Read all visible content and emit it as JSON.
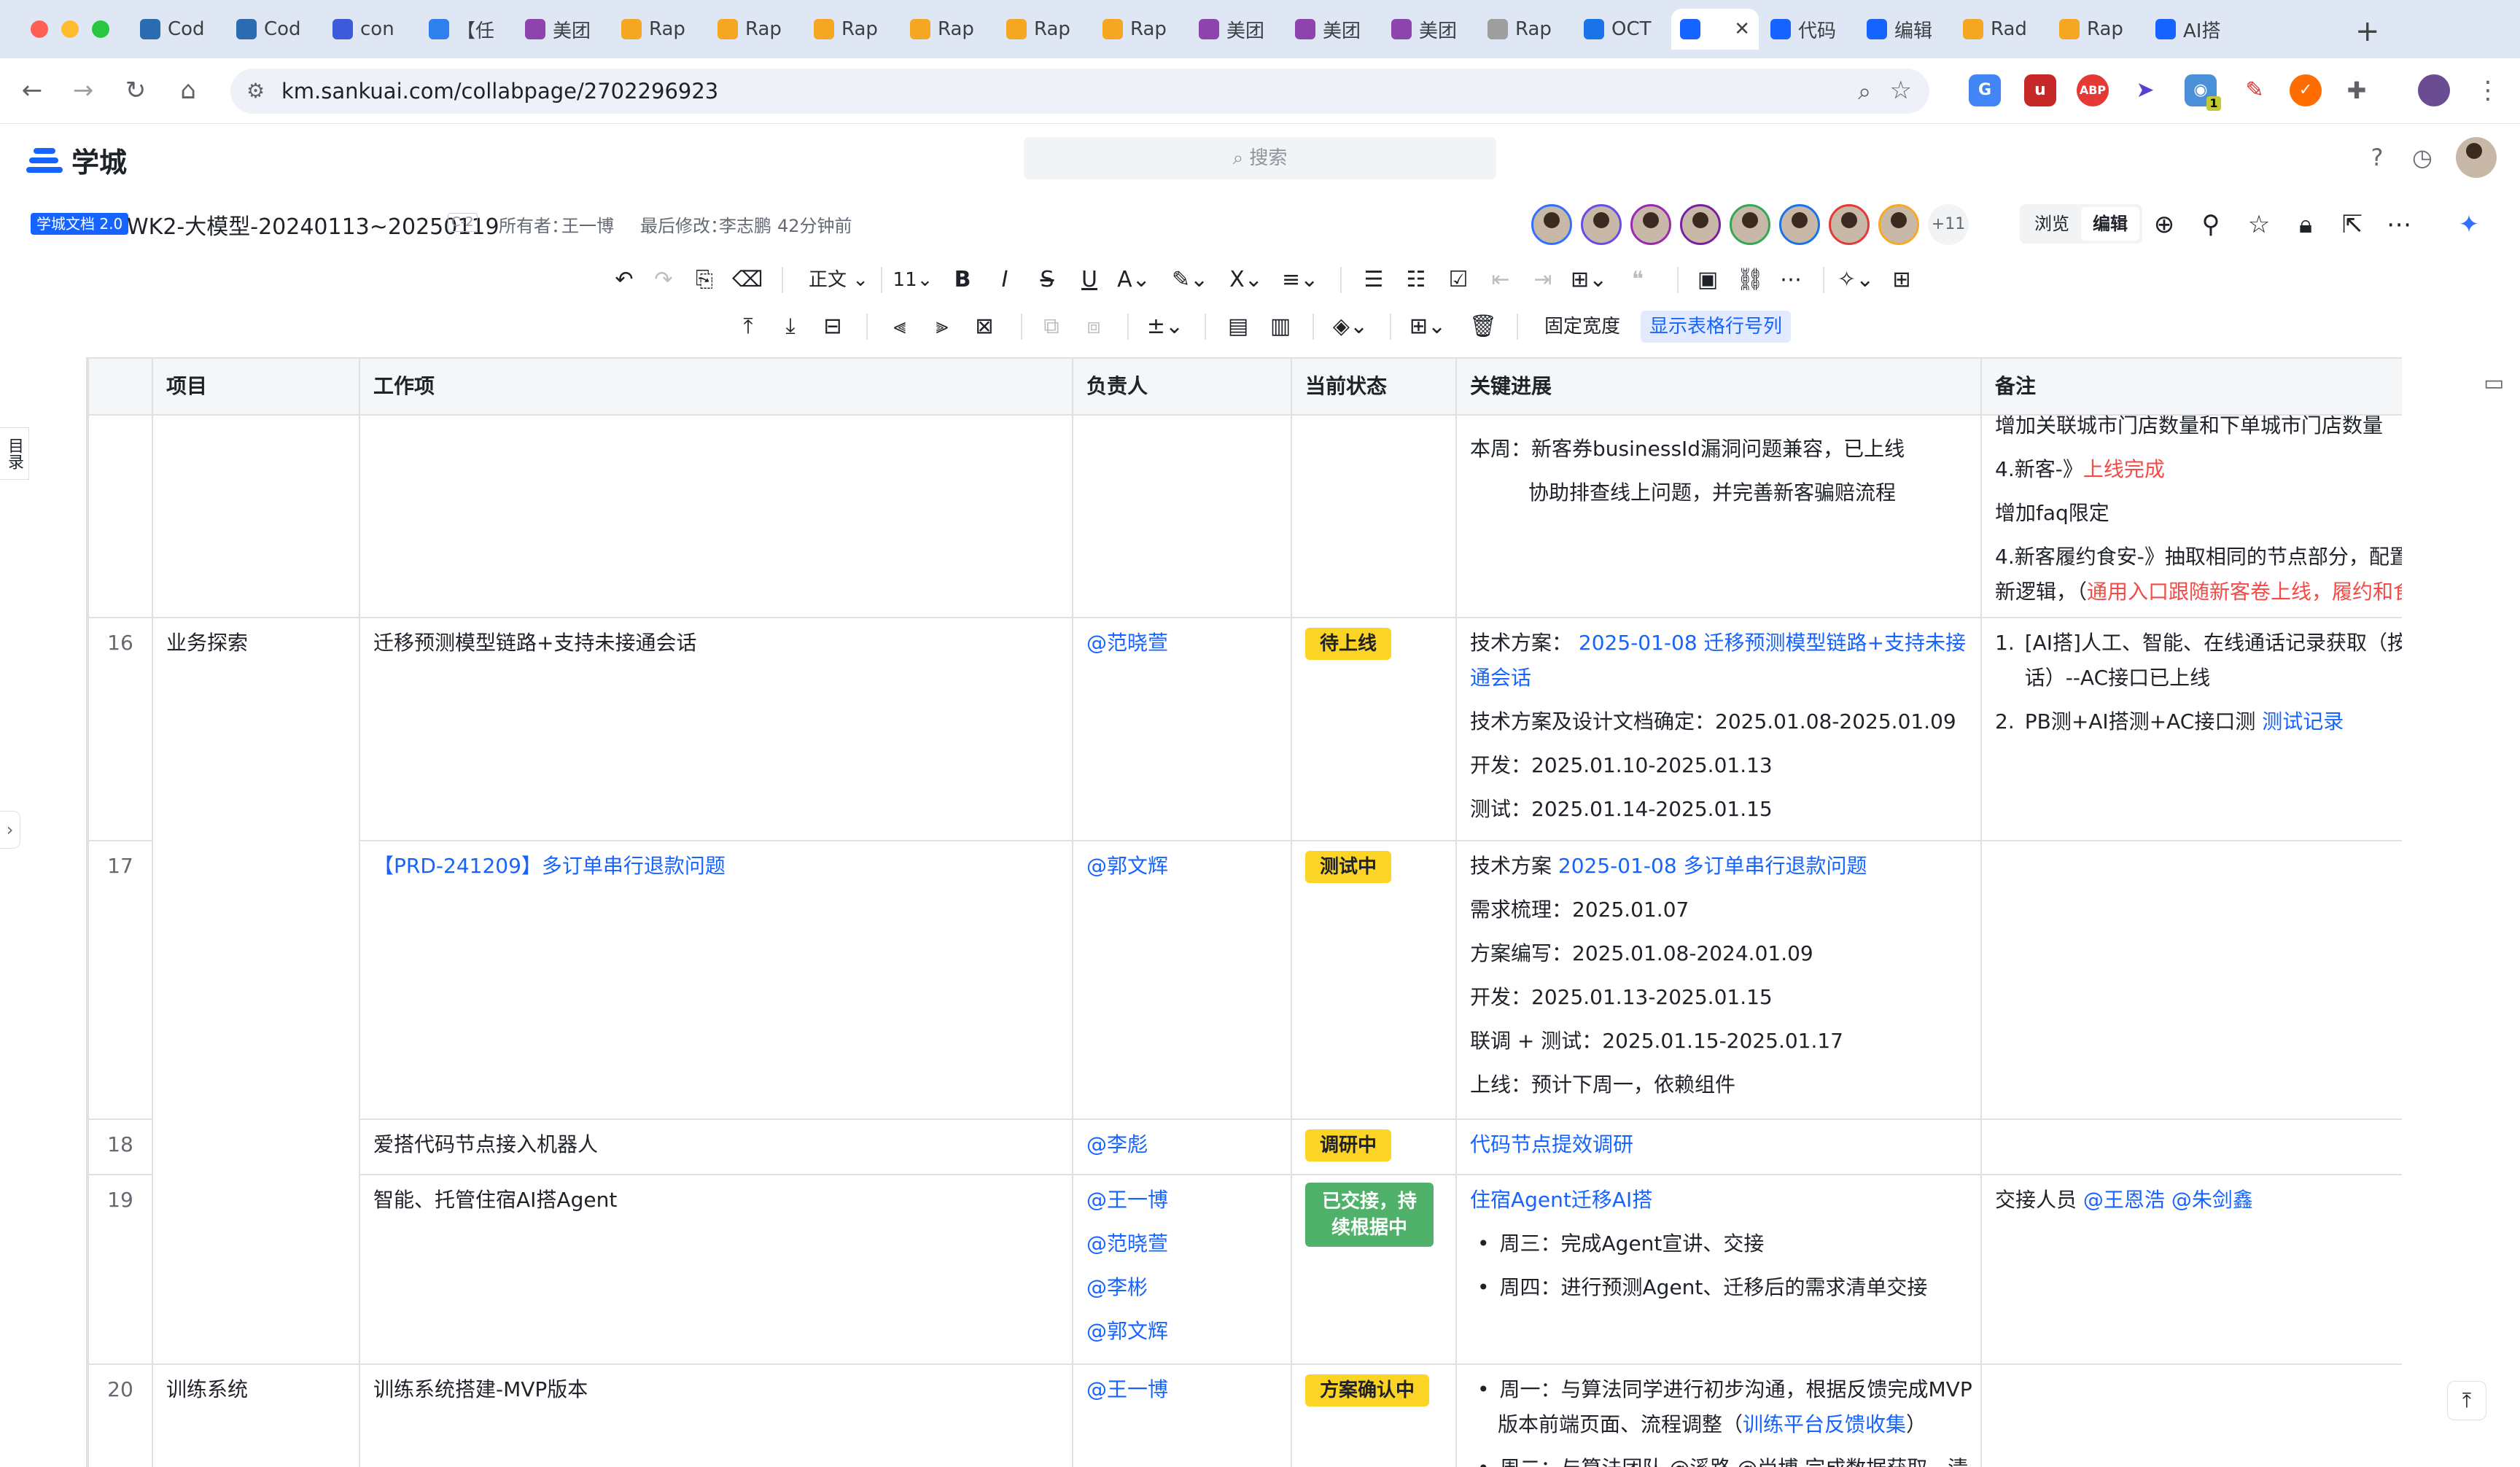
{
  "browser": {
    "tabs": [
      "Cod",
      "Cod",
      "con",
      "【任",
      "美团",
      "Rap",
      "Rap",
      "Rap",
      "Rap",
      "Rap",
      "Rap",
      "美团",
      "美团",
      "美团",
      "Rap",
      "OCT",
      "",
      "代码",
      "编辑",
      "Rad",
      "Rap",
      "AI搭"
    ],
    "active_tab_index": 16,
    "url": "km.sankuai.com/collabpage/2702296923",
    "new_tab": "+",
    "extension_badge": "1"
  },
  "app": {
    "logo_name": "学城",
    "search_placeholder": "搜索"
  },
  "doc": {
    "badge": "学城文档 2.0",
    "title": "WK2-大模型-20240113~20250119",
    "level": "C-2",
    "owner_label": "所有者：",
    "owner": "王一博",
    "modified_label": "最后修改：",
    "modified_by": "李志鹏",
    "modified_time": "42分钟前",
    "collaborators_extra": "+11",
    "mode_view": "浏览",
    "mode_edit": "编辑"
  },
  "toolbar": {
    "paragraph_style": "正文",
    "font_size": "11",
    "width_mode": "固定宽度",
    "show_row_numbers": "显示表格行号列"
  },
  "sidebar": {
    "toc_label": "目录"
  },
  "table": {
    "headers": [
      "项目",
      "工作项",
      "负责人",
      "当前状态",
      "关键进展",
      "备注"
    ],
    "row_prev": {
      "progress": [
        "本周：新客券businessId漏洞问题兼容，已上线",
        "协助排查线上问题，并完善新客骗赔流程"
      ],
      "notes": [
        "增加关联城市门店数量和下单城市门店数量",
        "4.新客-》",
        "上线完成",
        "增加faq限定",
        "4.新客履约食安-》抽取相同的节点部分，配置",
        "新逻辑，（",
        "通用入口跟随新客卷上线，履约和食"
      ]
    },
    "row16": {
      "num": "16",
      "project": "业务探索",
      "item": "迁移预测模型链路+支持未接通会话",
      "owner": "@范晓萱",
      "status": "待上线",
      "progress_label": "技术方案：",
      "progress_link": "2025-01-08 迁移预测模型链路+支持未接通会话",
      "progress": [
        "技术方案及设计文档确定：2025.01.08-2025.01.09",
        "开发：2025.01.10-2025.01.13",
        "测试：2025.01.14-2025.01.15"
      ],
      "notes_1a": "[AI搭]人工、智能、在线通话记录获取（按",
      "notes_1b": "话）--AC接口已上线",
      "notes_2": "PB测+AI搭测+AC接口测",
      "notes_2_link": "测试记录"
    },
    "row17": {
      "num": "17",
      "item_link": "【PRD-241209】多订单串行退款问题",
      "owner": "@郭文辉",
      "status": "测试中",
      "progress_label": "技术方案",
      "progress_link": "2025-01-08 多订单串行退款问题",
      "progress": [
        "需求梳理：2025.01.07",
        "方案编写：2025.01.08-2024.01.09",
        "开发：2025.01.13-2025.01.15",
        "联调 + 测试：2025.01.15-2025.01.17",
        "上线：预计下周一，依赖组件"
      ]
    },
    "row18": {
      "num": "18",
      "item": "爱搭代码节点接入机器人",
      "owner": "@李彪",
      "status": "调研中",
      "progress_link": "代码节点提效调研"
    },
    "row19": {
      "num": "19",
      "item": "智能、托管住宿AI搭Agent",
      "owners": [
        "@王一博",
        "@范晓萱",
        "@李彬",
        "@郭文辉"
      ],
      "status": "已交接，持续根据中",
      "progress_link": "住宿Agent迁移AI搭",
      "bullets": [
        "周三：完成Agent宣讲、交接",
        "周四：进行预测Agent、迁移后的需求清单交接"
      ],
      "notes_label": "交接人员",
      "notes_people": [
        "@王恩浩",
        "@朱剑鑫"
      ]
    },
    "row20": {
      "num": "20",
      "project": "训练系统",
      "item": "训练系统搭建-MVP版本",
      "owner": "@王一博",
      "status": "方案确认中",
      "bullet1a": "周一：与算法同学进行初步沟通，根据反馈完成MVP",
      "bullet1b": "版本前端页面、流程调整（",
      "bullet1_link": "训练平台反馈收集",
      "bullet1c": "）",
      "bullet2": "周二：与算法团队 @溪路 @尚博 完成数据获取，清"
    }
  }
}
